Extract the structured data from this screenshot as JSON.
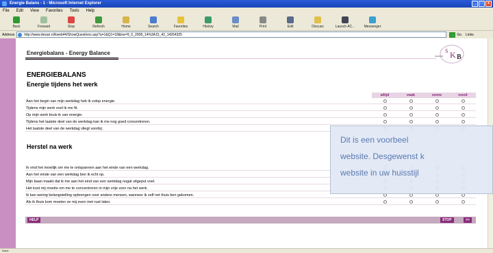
{
  "window": {
    "title": "Energie Balans - 1 - Microsoft Internet Explorer",
    "minimize": "_",
    "maximize": "□",
    "close": "x"
  },
  "menu": [
    "File",
    "Edit",
    "View",
    "Favorites",
    "Tools",
    "Help"
  ],
  "toolbar": [
    {
      "label": "Back",
      "icon": "back-arrow-icon",
      "color": "#2e9a2e"
    },
    {
      "label": "Forward",
      "icon": "forward-arrow-icon",
      "color": "#9fbf9f"
    },
    {
      "label": "Stop",
      "icon": "stop-icon",
      "color": "#d44"
    },
    {
      "label": "Refresh",
      "icon": "refresh-icon",
      "color": "#3d9a3d"
    },
    {
      "label": "Home",
      "icon": "home-icon",
      "color": "#d9b44a"
    },
    {
      "label": "Search",
      "icon": "search-icon",
      "color": "#4a7bd0"
    },
    {
      "label": "Favorites",
      "icon": "favorites-star-icon",
      "color": "#e8c23a"
    },
    {
      "label": "History",
      "icon": "history-icon",
      "color": "#3a9a6a"
    },
    {
      "label": "Mail",
      "icon": "mail-icon",
      "color": "#6a8cc8"
    },
    {
      "label": "Print",
      "icon": "print-icon",
      "color": "#888"
    },
    {
      "label": "Edit",
      "icon": "edit-icon",
      "color": "#5a6a8a"
    },
    {
      "label": "Discuss",
      "icon": "discuss-icon",
      "color": "#e0c04a"
    },
    {
      "label": "Launch AC...",
      "icon": "launch-icon",
      "color": "#445"
    },
    {
      "label": "Messenger",
      "icon": "messenger-icon",
      "color": "#3aa0d0"
    }
  ],
  "address": {
    "label": "Address",
    "url": "http://www.desan.nl/kweb44/ShowQuestions.asp?a=1&Q1=18&ine=9_5_2008_14%3A15_42_14264325",
    "go": "Go",
    "links": "Links"
  },
  "page": {
    "header": "Energiebalans - Energy Balance",
    "logo_text": "SKB",
    "title": "ENERGIEBALANS",
    "section1": "Energie tijdens het werk",
    "section2": "Herstel na werk",
    "columns": [
      "altijd",
      "vaak",
      "soms",
      "nooit"
    ],
    "rows1": [
      "Aan het begin van mijn werkdag heb ik volop energie.",
      "Tijdens mijn werk voel ik me fit.",
      "Op mijn werk bruis ik van energie.",
      "Tijdens het laatste deel van de werkdag kan ik me nog goed concentreren.",
      "Het laatste deel van de werkdag vliegt voorbij."
    ],
    "rows2": [
      "Ik vind het moeilijk om me te ontspannen aan het einde van een werkdag.",
      "Aan het einde van een werkdag ben ik echt op.",
      "Mijn baan maakt dat ik me aan het eind van een werkdag nogal uitgeput voel.",
      "Het kost mij moeite om me te concentreren in mijn vrije uren na het werk.",
      "Ik kan weinig belangstelling opbrengen voor andere mensen, wanneer ik zelf net thuis ben gekomen.",
      "Als ik thuis kom moeten ze mij even met rust laten."
    ],
    "help": "HELP",
    "stop": "STOP",
    "next": ">>"
  },
  "overlay": {
    "line1": "Dit   is   een   voorbeel",
    "line2": "website. Desgewenst k",
    "line3": "website in uw huisstijl"
  },
  "status": {
    "text": "Done"
  }
}
